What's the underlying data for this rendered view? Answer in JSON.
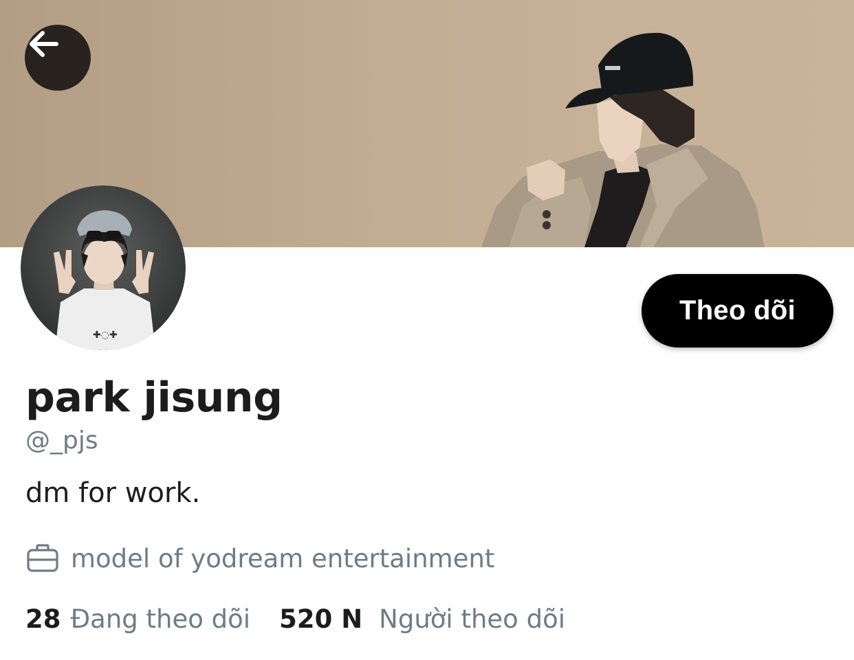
{
  "header": {
    "back_icon": "arrow-left-icon",
    "banner_image": "profile-banner-photo"
  },
  "profile": {
    "avatar_image": "profile-avatar-photo",
    "display_name": "park jisung",
    "handle": "@_pjs",
    "bio": "dm for work.",
    "work": {
      "icon": "briefcase-icon",
      "text": "model of yodream entertainment"
    },
    "follow_button_label": "Theo dõi",
    "stats": {
      "following_count": "28",
      "following_label": "Đang theo dõi",
      "followers_count": "520 N",
      "followers_label": "Người theo dõi"
    }
  },
  "colors": {
    "banner": "#c2ac93",
    "follow_button_bg": "#000000",
    "secondary_text": "#6e7b87",
    "primary_text": "#1c1c1c"
  }
}
